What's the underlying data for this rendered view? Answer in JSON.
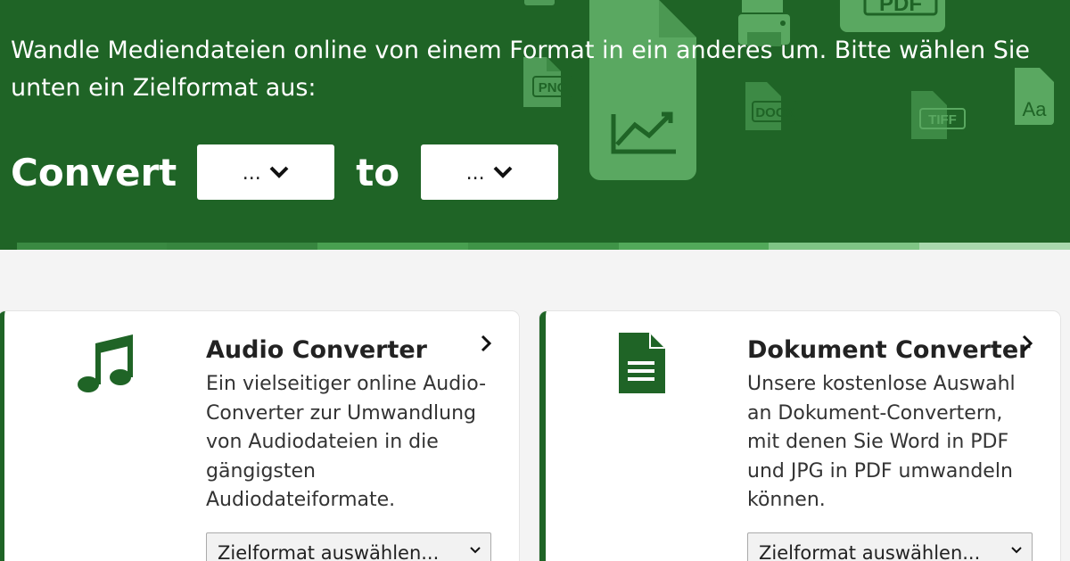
{
  "hero": {
    "intro": "Wandle Mediendateien online von einem Format in ein anderes um. Bitte wählen Sie unten ein Zielformat aus:",
    "convert_label": "Convert",
    "to_label": "to",
    "from_select_value": "...",
    "to_select_value": "...",
    "deco_labels": {
      "png": "PNG",
      "docx": "DOCX",
      "tiff": "TIFF",
      "font": "Aa",
      "pdf": "PDF"
    }
  },
  "cards": [
    {
      "title": "Audio Converter",
      "description": "Ein vielseitiger online Audio-Converter zur Umwandlung von Audiodateien in die gängigsten Audiodateiformate.",
      "select_label": "Zielformat auswählen...",
      "icon": "music-note-icon"
    },
    {
      "title": "Dokument Converter",
      "description": "Unsere kostenlose Auswahl an Dokument-Convertern, mit denen Sie Word in PDF und JPG in PDF umwandeln können.",
      "select_label": "Zielformat auswählen...",
      "icon": "document-icon"
    }
  ],
  "colors": {
    "brand_green": "#1f6426",
    "light_green": "#5aa861",
    "background": "#f4f4f4"
  }
}
